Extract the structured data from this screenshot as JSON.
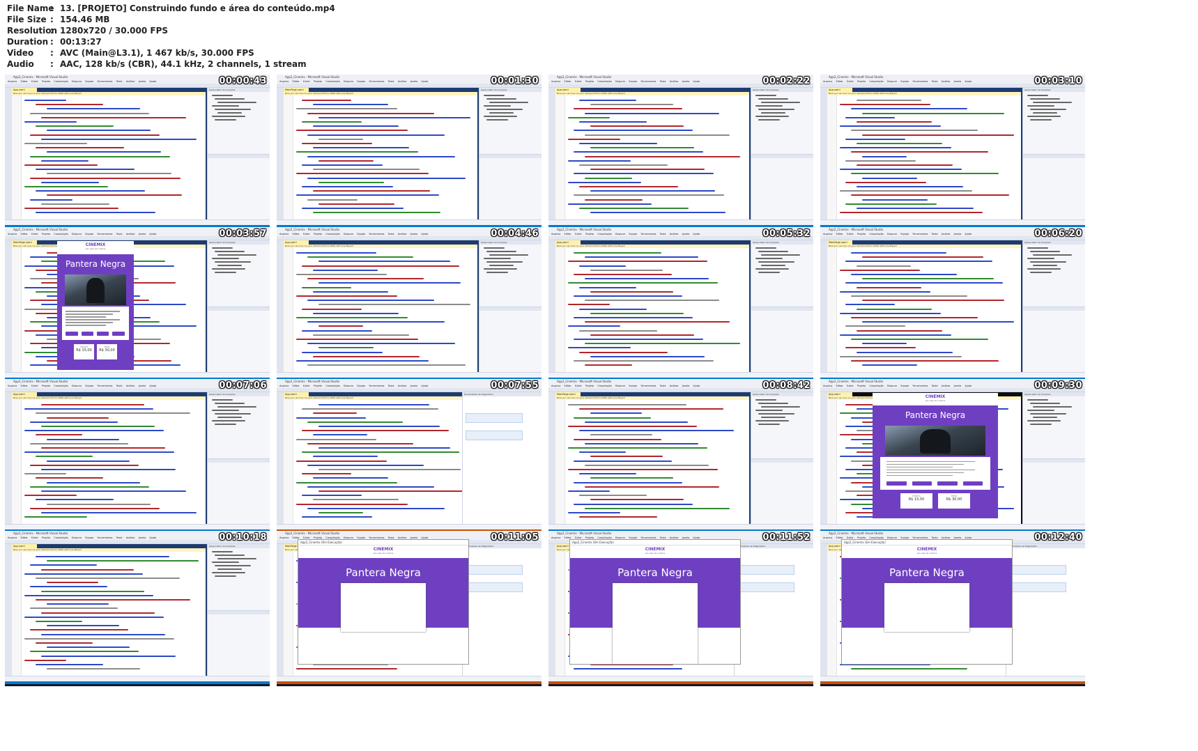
{
  "info": {
    "rows": [
      {
        "label": "File Name",
        "value": "13. [PROJETO] Construindo fundo e área do conteúdo.mp4"
      },
      {
        "label": "File Size",
        "value": "154.46 MB"
      },
      {
        "label": "Resolution",
        "value": "1280x720 / 30.000 FPS"
      },
      {
        "label": "Duration",
        "value": "00:13:27"
      },
      {
        "label": "Video",
        "value": "AVC (Main@L3.1), 1 467 kb/s, 30.000 FPS"
      },
      {
        "label": "Audio",
        "value": "AAC, 128 kb/s (CBR), 44.1 kHz, 2 channels, 1 stream"
      }
    ],
    "separator": ":"
  },
  "vs": {
    "window_title": "App2_Cinemix - Microsoft Visual Studio",
    "menu": "Arquivo Editar Exibir Projeto Compilação Depurar Equipe Ferramentas Teste Análise Janela Ajuda",
    "tab": "App.xaml",
    "tab_main": "MainPage.xaml",
    "notice": "Now you can live run your Xamarin.Forms XAML with Live Player!",
    "solution_header": "Gerenciador de Soluções",
    "diag_header": "Ferramentas de Diagnóstico"
  },
  "app": {
    "logo": "CINEMIX",
    "subtitle": "seu app de cinema",
    "movie_title": "Pantera Negra",
    "price_label_1": "Inteira",
    "price_label_2": "Meia",
    "price_1": "R$ 15,00",
    "price_2": "R$ 30,00",
    "window_title": "App2_Cinemix (Em Execução)"
  },
  "thumbs": [
    {
      "timestamp": "00:00:43"
    },
    {
      "timestamp": "00:01:30"
    },
    {
      "timestamp": "00:02:22"
    },
    {
      "timestamp": "00:03:10"
    },
    {
      "timestamp": "00:03:57"
    },
    {
      "timestamp": "00:04:46"
    },
    {
      "timestamp": "00:05:32"
    },
    {
      "timestamp": "00:06:20"
    },
    {
      "timestamp": "00:07:06"
    },
    {
      "timestamp": "00:07:55"
    },
    {
      "timestamp": "00:08:42"
    },
    {
      "timestamp": "00:09:30"
    },
    {
      "timestamp": "00:10:18"
    },
    {
      "timestamp": "00:11:05"
    },
    {
      "timestamp": "00:11:52"
    },
    {
      "timestamp": "00:12:40"
    }
  ],
  "colors": {
    "vs_blue": "#1e3b70",
    "status_blue": "#007acc",
    "status_orange": "#ca5100",
    "app_purple": "#6f3fc2"
  }
}
